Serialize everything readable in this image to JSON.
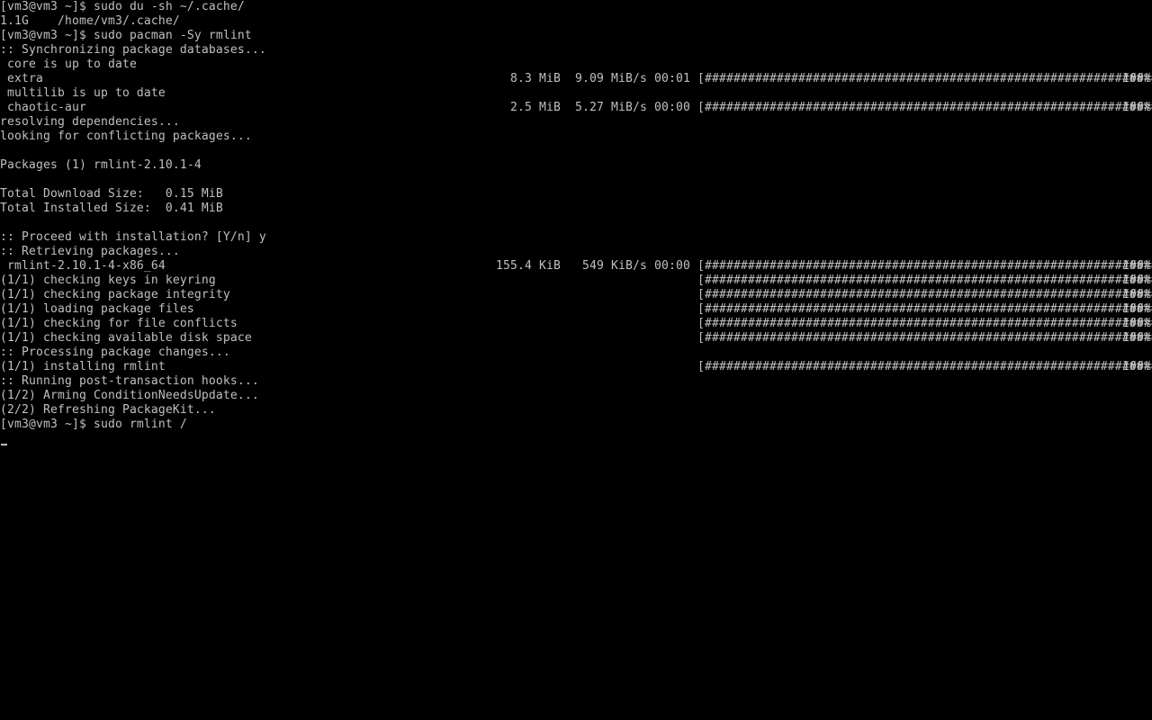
{
  "terminal": {
    "lines": [
      {
        "text": "[vm3@vm3 ~]$ sudo du -sh ~/.cache/"
      },
      {
        "text": "1.1G    /home/vm3/.cache/"
      },
      {
        "text": "[vm3@vm3 ~]$ sudo pacman -Sy rmlint"
      },
      {
        "text": ":: Synchronizing package databases..."
      },
      {
        "text": " core is up to date"
      },
      {
        "text": " extra",
        "size": "8.3 MiB",
        "rate": "9.09 MiB/s",
        "time": "00:01",
        "bar": "[################################################################]",
        "pct": "100%"
      },
      {
        "text": " multilib is up to date"
      },
      {
        "text": " chaotic-aur",
        "size": "2.5 MiB",
        "rate": "5.27 MiB/s",
        "time": "00:00",
        "bar": "[################################################################]",
        "pct": "100%"
      },
      {
        "text": "resolving dependencies..."
      },
      {
        "text": "looking for conflicting packages..."
      },
      {
        "text": ""
      },
      {
        "text": "Packages (1) rmlint-2.10.1-4"
      },
      {
        "text": ""
      },
      {
        "text": "Total Download Size:   0.15 MiB"
      },
      {
        "text": "Total Installed Size:  0.41 MiB"
      },
      {
        "text": ""
      },
      {
        "text": ":: Proceed with installation? [Y/n] y"
      },
      {
        "text": ":: Retrieving packages..."
      },
      {
        "text": " rmlint-2.10.1-4-x86_64",
        "size": "155.4 KiB",
        "rate": "549 KiB/s",
        "time": "00:00",
        "bar": "[################################################################]",
        "pct": "100%"
      },
      {
        "text": "(1/1) checking keys in keyring",
        "bar": "[################################################################]",
        "pct": "100%"
      },
      {
        "text": "(1/1) checking package integrity",
        "bar": "[################################################################]",
        "pct": "100%"
      },
      {
        "text": "(1/1) loading package files",
        "bar": "[################################################################]",
        "pct": "100%"
      },
      {
        "text": "(1/1) checking for file conflicts",
        "bar": "[################################################################]",
        "pct": "100%"
      },
      {
        "text": "(1/1) checking available disk space",
        "bar": "[################################################################]",
        "pct": "100%"
      },
      {
        "text": ":: Processing package changes..."
      },
      {
        "text": "(1/1) installing rmlint",
        "bar": "[################################################################]",
        "pct": "100%"
      },
      {
        "text": ":: Running post-transaction hooks..."
      },
      {
        "text": "(1/2) Arming ConditionNeedsUpdate..."
      },
      {
        "text": "(2/2) Refreshing PackageKit..."
      },
      {
        "text": "[vm3@vm3 ~]$ sudo rmlint /"
      }
    ]
  }
}
